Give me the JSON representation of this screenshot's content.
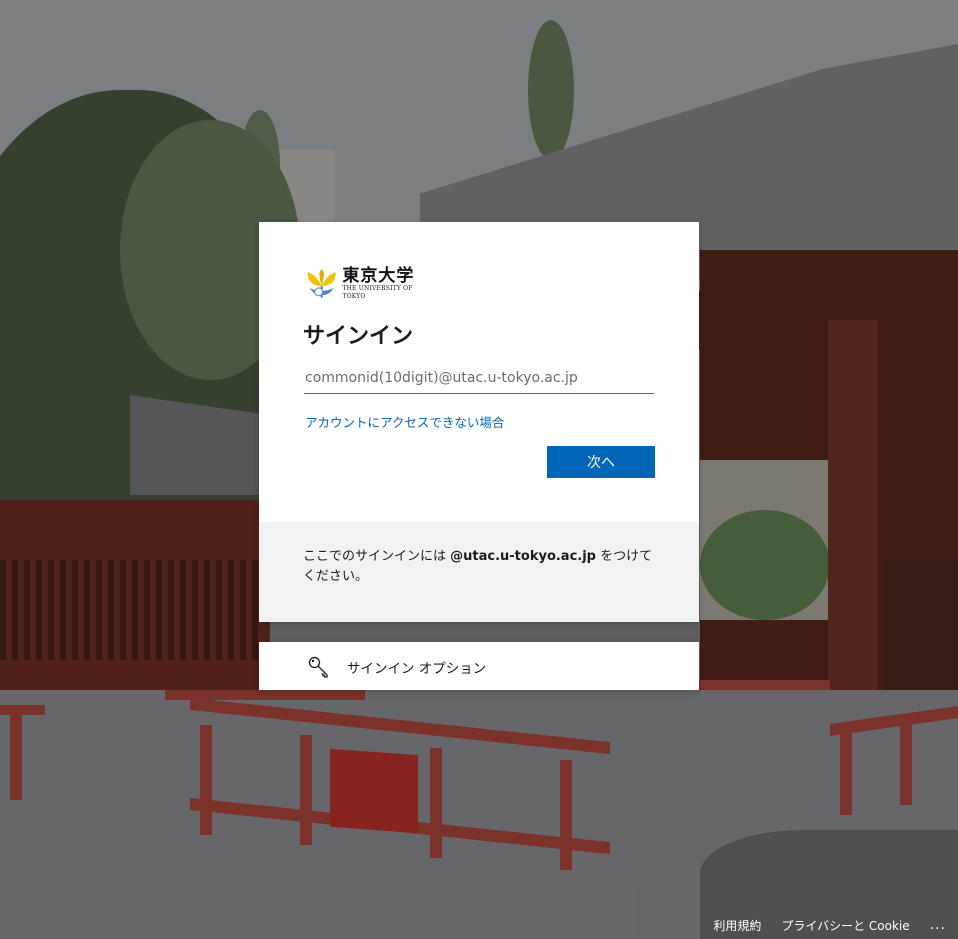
{
  "logo": {
    "name_jp": "東京大学",
    "name_en": "THE UNIVERSITY OF TOKYO"
  },
  "signin": {
    "title": "サインイン",
    "email_placeholder": "commonid(10digit)@utac.u-tokyo.ac.jp",
    "email_value": "",
    "cant_access_link": "アカウントにアクセスできない場合",
    "next_button": "次へ"
  },
  "info": {
    "prefix": "ここでのサインインには ",
    "domain": "@utac.u-tokyo.ac.jp",
    "suffix": " をつけてください。"
  },
  "options": {
    "label": "サインイン オプション",
    "icon": "key-icon"
  },
  "footer": {
    "terms": "利用規約",
    "privacy": "プライバシーと Cookie",
    "more": "..."
  },
  "colors": {
    "accent": "#0067b8",
    "info_bg": "#f2f2f2",
    "logo_gold": "#f2c200",
    "logo_blue": "#4f86c6"
  }
}
